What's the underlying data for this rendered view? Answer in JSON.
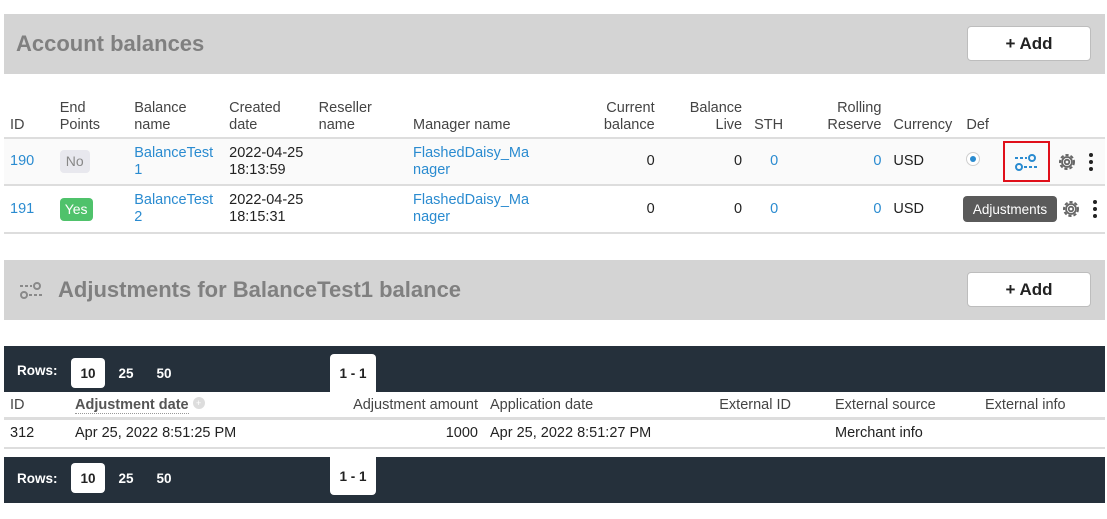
{
  "account_balances": {
    "title": "Account balances",
    "add_label": "+ Add",
    "columns": {
      "id": "ID",
      "end_points": [
        "End",
        "Points"
      ],
      "balance_name": [
        "Balance",
        "name"
      ],
      "created_date": [
        "Created",
        "date"
      ],
      "reseller_name": [
        "Reseller",
        "name"
      ],
      "manager_name": "Manager name",
      "current_balance": [
        "Current",
        "balance"
      ],
      "balance_live": [
        "Balance",
        "Live"
      ],
      "sth": "STH",
      "rolling_reserve": [
        "Rolling",
        "Reserve"
      ],
      "currency": "Currency",
      "def": "Def"
    },
    "rows": [
      {
        "id": "190",
        "end_points": "No",
        "balance_name": [
          "BalanceTest",
          "1"
        ],
        "created": [
          "2022-04-25",
          "18:13:59"
        ],
        "reseller": "",
        "manager": [
          "FlashedDaisy_Ma",
          "nager"
        ],
        "current_balance": "0",
        "balance_live": "0",
        "sth": "0",
        "rolling_reserve": "0",
        "currency": "USD",
        "default": true
      },
      {
        "id": "191",
        "end_points": "Yes",
        "balance_name": [
          "BalanceTest",
          "2"
        ],
        "created": [
          "2022-04-25",
          "18:15:31"
        ],
        "reseller": "",
        "manager": [
          "FlashedDaisy_Ma",
          "nager"
        ],
        "current_balance": "0",
        "balance_live": "0",
        "sth": "0",
        "rolling_reserve": "0",
        "currency": "USD",
        "default": false
      }
    ],
    "tooltip": "Adjustments"
  },
  "adjustments": {
    "title": "Adjustments for BalanceTest1 balance",
    "add_label": "+ Add",
    "rows_label": "Rows:",
    "page_sizes": [
      "10",
      "25",
      "50"
    ],
    "selected_page_size": "10",
    "page_range": "1 - 1",
    "columns": {
      "id": "ID",
      "adjustment_date": "Adjustment date",
      "adjustment_amount": "Adjustment amount",
      "application_date": "Application date",
      "external_id": "External ID",
      "external_source": "External source",
      "external_info": "External info"
    },
    "rows": [
      {
        "id": "312",
        "adjustment_date": "Apr 25, 2022 8:51:25 PM",
        "adjustment_amount": "1000",
        "application_date": "Apr 25, 2022 8:51:27 PM",
        "external_id": "",
        "external_source": "Merchant info",
        "external_info": ""
      }
    ]
  },
  "colors": {
    "link": "#2a8bd0",
    "header_bg": "#d4d4d4",
    "dark_bar": "#25303b",
    "badge_yes": "#4fc26b",
    "highlight": "#e0101a"
  },
  "icons": {
    "adjustments": "sliders-icon",
    "settings": "gear-icon",
    "more": "kebab-icon",
    "sort": "sort-icon"
  }
}
